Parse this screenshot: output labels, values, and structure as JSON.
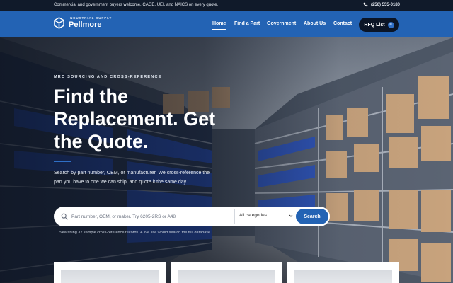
{
  "topbar": {
    "message": "Commercial and government buyers welcome. CAGE, UEI, and NAICS on every quote.",
    "phone": "(256) 555-0180"
  },
  "brand": {
    "tagline": "INDUSTRIAL SUPPLY",
    "name": "Pellmore"
  },
  "nav": {
    "items": [
      {
        "label": "Home",
        "active": true
      },
      {
        "label": "Find a Part",
        "active": false
      },
      {
        "label": "Government",
        "active": false
      },
      {
        "label": "About Us",
        "active": false
      },
      {
        "label": "Contact",
        "active": false
      }
    ],
    "rfq_label": "RFQ List",
    "rfq_count": "0"
  },
  "hero": {
    "eyebrow": "MRO SOURCING AND CROSS-REFERENCE",
    "headline": "Find the Replacement. Get the Quote.",
    "lead": "Search by part number, OEM, or manufacturer. We cross-reference the part you have to one we can ship, and quote it the same day."
  },
  "search": {
    "placeholder": "Part number, OEM, or maker. Try 6205-2RS or A48",
    "category_selected": "All categories",
    "button_label": "Search",
    "note": "Searching 32 sample cross-reference records. A live site would search the full database."
  },
  "colors": {
    "brand_blue": "#2363b4",
    "topbar_bg": "#101a2a",
    "rfq_bg": "#0b1526",
    "accent": "#2f6fc6"
  }
}
